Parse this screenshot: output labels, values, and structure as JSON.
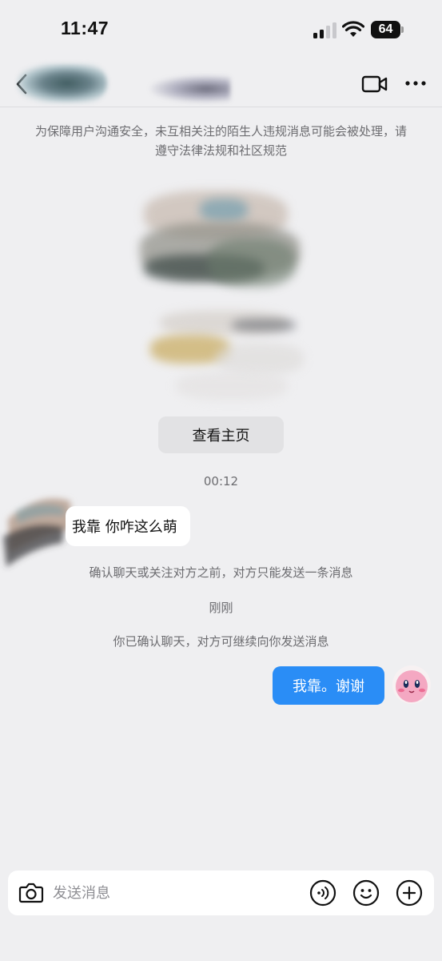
{
  "status_bar": {
    "time": "11:47",
    "battery": "64"
  },
  "header": {
    "back_icon": "chevron-left-icon",
    "video_icon": "video-camera-icon",
    "more_icon": "more-dots-icon"
  },
  "notice": {
    "safety": "为保障用户沟通安全，未互相关注的陌生人违规消息可能会被处理，请遵守法律法规和社区规范"
  },
  "profile": {
    "view_profile_label": "查看主页"
  },
  "messages": [
    {
      "time": "00:12"
    },
    {
      "direction": "in",
      "text": "我靠 你咋这么萌"
    }
  ],
  "system_notes": {
    "confirm_limit": "确认聊天或关注对方之前，对方只能发送一条消息",
    "just_now": "刚刚",
    "confirmed": "你已确认聊天，对方可继续向你发送消息"
  },
  "sent_message": {
    "text": "我靠。谢谢"
  },
  "input_bar": {
    "placeholder": "发送消息",
    "camera_icon": "camera-icon",
    "voice_icon": "voice-wave-icon",
    "emoji_icon": "emoji-face-icon",
    "plus_icon": "plus-circle-icon"
  },
  "colors": {
    "accent": "#2a8df6",
    "background": "#efeff1",
    "bubble_in": "#ffffff",
    "muted_text": "#6c6c70"
  }
}
